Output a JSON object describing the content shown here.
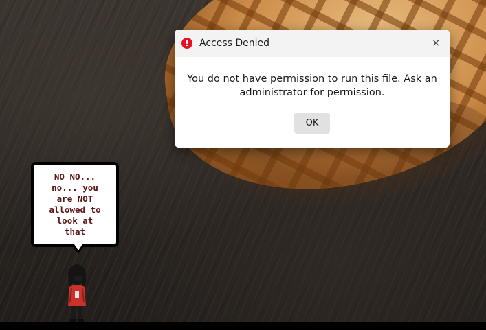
{
  "dialog": {
    "title": "Access Denied",
    "icon": "error-icon",
    "close_label": "×",
    "message": "You do not have permission to run this file. Ask an administrator for permission.",
    "ok_label": "OK"
  },
  "bubble": {
    "text": "NO NO...\nno... you\nare NOT\nallowed to\nlook at\nthat"
  },
  "colors": {
    "error_red": "#e81123",
    "dialog_bg": "#ffffff",
    "titlebar_bg": "#f3f3f3",
    "ok_button_bg": "#e1e1e1",
    "bubble_text": "#5c1616",
    "character_hoodie": "#c8322b"
  }
}
